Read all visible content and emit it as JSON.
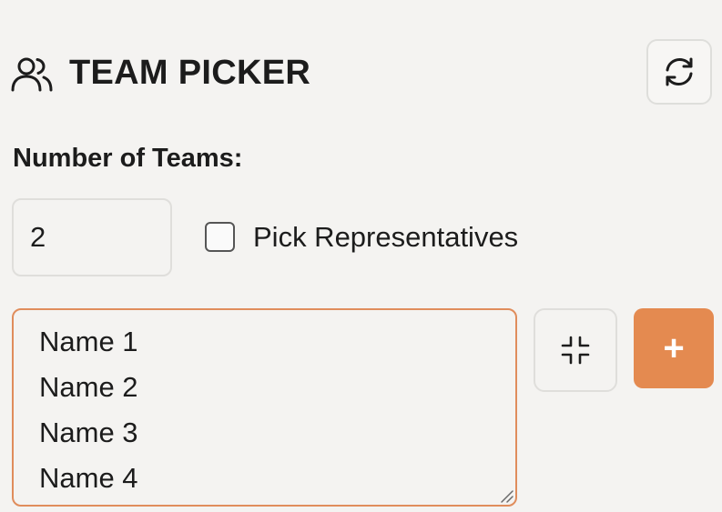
{
  "header": {
    "title": "TEAM PICKER",
    "icon": "users-icon",
    "refresh_icon": "refresh-icon"
  },
  "form": {
    "teams_label": "Number of Teams:",
    "teams_value": "2",
    "pick_representatives_label": "Pick Representatives",
    "pick_representatives_checked": false,
    "names_value": "Name 1\nName 2\nName 3\nName 4",
    "collapse_icon": "collapse-icon",
    "add_label": "+"
  },
  "colors": {
    "background": "#f4f3f1",
    "accent": "#e48a50",
    "focus_border": "#e08d5c"
  }
}
